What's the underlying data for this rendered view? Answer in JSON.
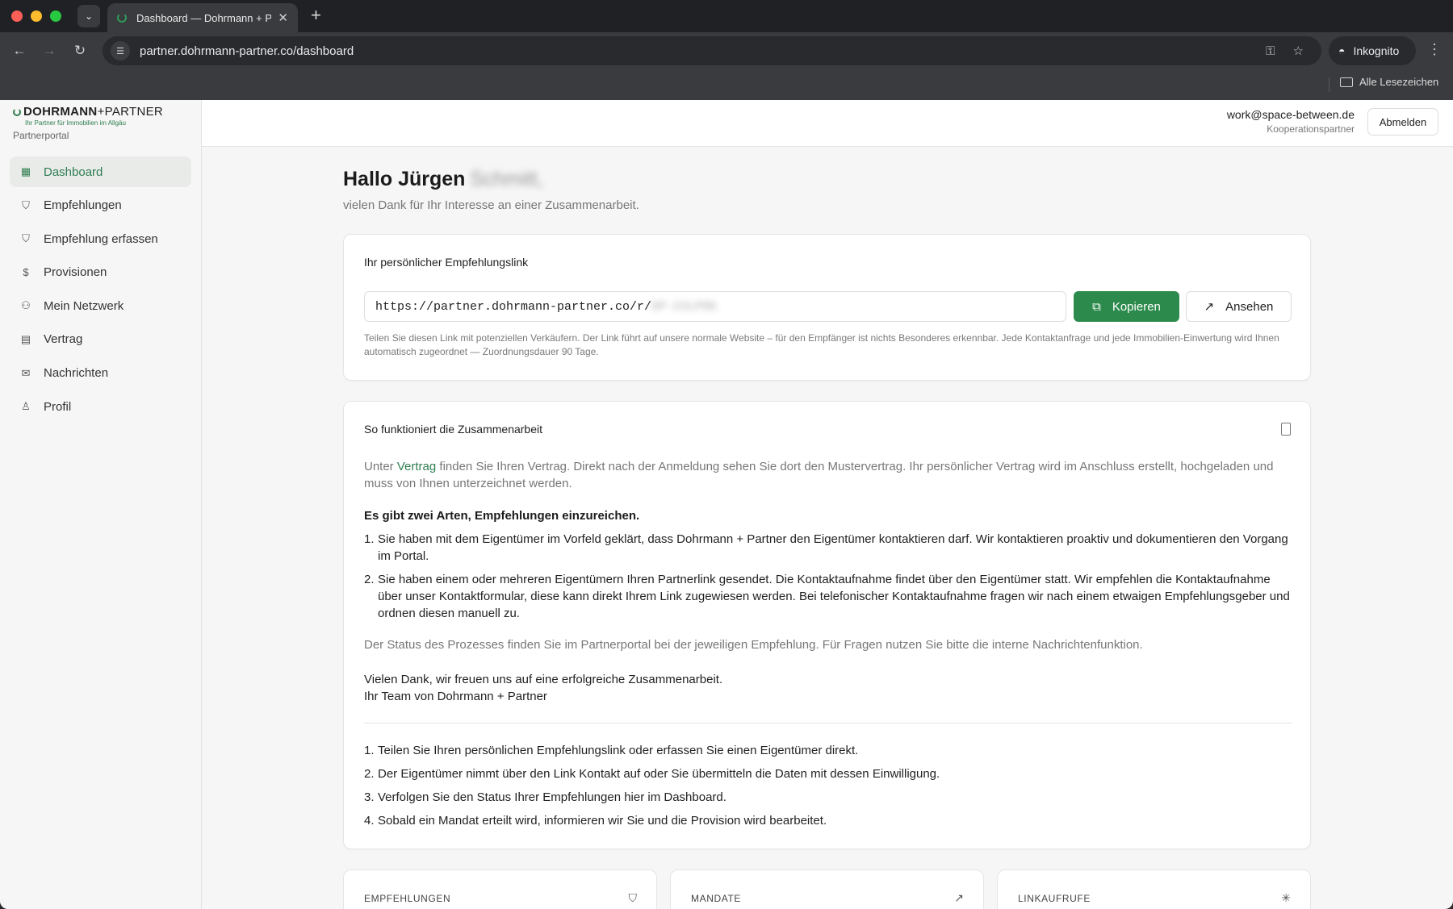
{
  "browser": {
    "tab_title": "Dashboard — Dohrmann + Pa",
    "url": "partner.dohrmann-partner.co/dashboard",
    "incognito_label": "Inkognito",
    "bookmarks_all": "Alle Lesezeichen"
  },
  "brand": {
    "name_bold": "DOHRMANN",
    "name_sep": "+",
    "name_rest": "PARTNER",
    "tagline": "Ihr Partner für Immobilien im Allgäu",
    "portal": "Partnerportal"
  },
  "sidebar": {
    "items": [
      {
        "label": "Dashboard",
        "icon": "dashboard-icon",
        "active": true
      },
      {
        "label": "Empfehlungen",
        "icon": "handshake-icon"
      },
      {
        "label": "Empfehlung erfassen",
        "icon": "handshake-icon"
      },
      {
        "label": "Provisionen",
        "icon": "money-icon"
      },
      {
        "label": "Mein Netzwerk",
        "icon": "users-icon"
      },
      {
        "label": "Vertrag",
        "icon": "document-icon"
      },
      {
        "label": "Nachrichten",
        "icon": "mail-icon"
      },
      {
        "label": "Profil",
        "icon": "user-icon"
      }
    ]
  },
  "header": {
    "email": "work@space-between.de",
    "role": "Kooperationspartner",
    "logout": "Abmelden"
  },
  "main": {
    "greeting": "Hallo Jürgen",
    "greeting_blurred": "Schmitt,",
    "subtitle": "vielen Dank für Ihr Interesse an einer Zusammenarbeit."
  },
  "link_card": {
    "title": "Ihr persönlicher Empfehlungslink",
    "link_value": "https://partner.dohrmann-partner.co/r/",
    "link_blurred": "DP-X3LP8K",
    "copy_label": "Kopieren",
    "view_label": "Ansehen",
    "hint": "Teilen Sie diesen Link mit potenziellen Verkäufern. Der Link führt auf unsere normale Website – für den Empfänger ist nichts Besonderes erkennbar. Jede Kontaktanfrage und jede Immobilien-Einwertung wird Ihnen automatisch zugeordnet — Zuordnungsdauer 90 Tage."
  },
  "howto_card": {
    "title": "So funktioniert die Zusammenarbeit",
    "intro_before": "Unter ",
    "intro_link": "Vertrag",
    "intro_after": " finden Sie Ihren Vertrag. Direkt nach der Anmeldung sehen Sie dort den Mustervertrag. Ihr persönlicher Vertrag wird im Anschluss erstellt, hochgeladen und muss von Ihnen unterzeichnet werden.",
    "subhead": "Es gibt zwei Arten, Empfehlungen einzureichen.",
    "ways": [
      {
        "num": "1.",
        "text": "Sie haben mit dem Eigentümer im Vorfeld geklärt, dass Dohrmann + Partner den Eigentümer kontaktieren darf. Wir kontaktieren proaktiv und dokumentieren den Vorgang im Portal."
      },
      {
        "num": "2.",
        "text": "Sie haben einem oder mehreren Eigentümern Ihren Partnerlink gesendet. Die Kontaktaufnahme findet über den Eigentümer statt. Wir empfehlen die Kontaktaufnahme über unser Kontaktformular, diese kann direkt Ihrem Link zugewiesen werden. Bei telefonischer Kontaktaufnahme fragen wir nach einem etwaigen Empfehlungsgeber und ordnen diesen manuell zu."
      }
    ],
    "status_note": "Der Status des Prozesses finden Sie im Partnerportal bei der jeweiligen Empfehlung. Für Fragen nutzen Sie bitte die interne Nachrichtenfunktion.",
    "thanks_line1": "Vielen Dank, wir freuen uns auf eine erfolgreiche Zusammenarbeit.",
    "thanks_line2": "Ihr Team von Dohrmann + Partner",
    "steps": [
      {
        "num": "1.",
        "text": "Teilen Sie Ihren persönlichen Empfehlungslink oder erfassen Sie einen Eigentümer direkt."
      },
      {
        "num": "2.",
        "text": "Der Eigentümer nimmt über den Link Kontakt auf oder Sie übermitteln die Daten mit dessen Einwilligung."
      },
      {
        "num": "3.",
        "text": "Verfolgen Sie den Status Ihrer Empfehlungen hier im Dashboard."
      },
      {
        "num": "4.",
        "text": "Sobald ein Mandat erteilt wird, informieren wir Sie und die Provision wird bearbeitet."
      }
    ]
  },
  "stats": [
    {
      "label": "EMPFEHLUNGEN",
      "icon": "handshake-icon"
    },
    {
      "label": "MANDATE",
      "icon": "trending-up-icon"
    },
    {
      "label": "LINKAUFRUFE",
      "icon": "click-icon"
    }
  ],
  "colors": {
    "accent": "#2c8a4c",
    "link": "#2e7d4f"
  }
}
